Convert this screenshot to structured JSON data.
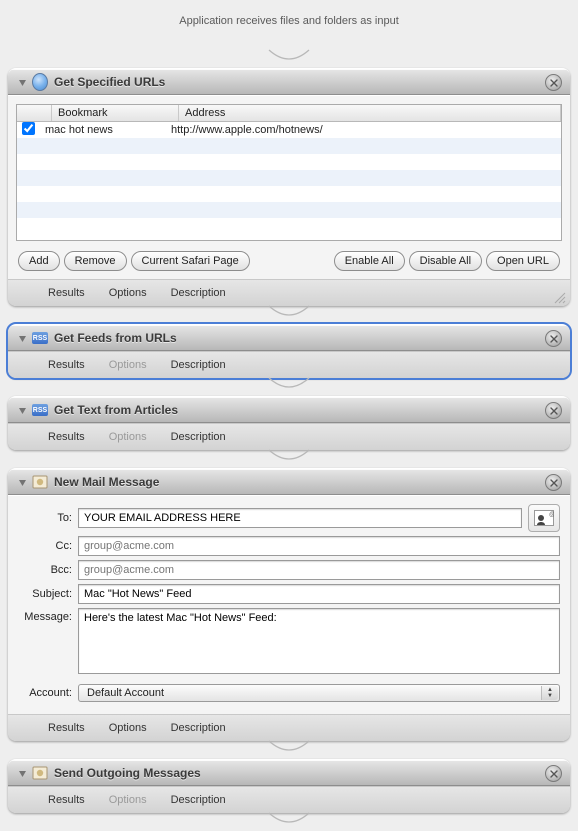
{
  "header": "Application receives files and folders as input",
  "footer_tabs": {
    "results": "Results",
    "options": "Options",
    "description": "Description"
  },
  "buttons": {
    "add": "Add",
    "remove": "Remove",
    "current_page": "Current Safari Page",
    "enable_all": "Enable All",
    "disable_all": "Disable All",
    "open_url": "Open URL"
  },
  "actions": {
    "get_urls": {
      "title": "Get Specified URLs",
      "columns": {
        "bookmark": "Bookmark",
        "address": "Address"
      },
      "rows": [
        {
          "checked": true,
          "bookmark": "mac hot news",
          "address": "http://www.apple.com/hotnews/"
        }
      ]
    },
    "get_feeds": {
      "title": "Get Feeds from URLs"
    },
    "get_text": {
      "title": "Get Text from Articles"
    },
    "new_mail": {
      "title": "New Mail Message",
      "labels": {
        "to": "To:",
        "cc": "Cc:",
        "bcc": "Bcc:",
        "subject": "Subject:",
        "message": "Message:",
        "account": "Account:"
      },
      "to_value": "YOUR EMAIL ADDRESS HERE",
      "cc_placeholder": "group@acme.com",
      "bcc_placeholder": "group@acme.com",
      "subject_value": "Mac \"Hot News\" Feed",
      "message_value": "Here's the latest Mac \"Hot News\" Feed:",
      "account_value": "Default Account"
    },
    "send_mail": {
      "title": "Send Outgoing Messages"
    }
  }
}
